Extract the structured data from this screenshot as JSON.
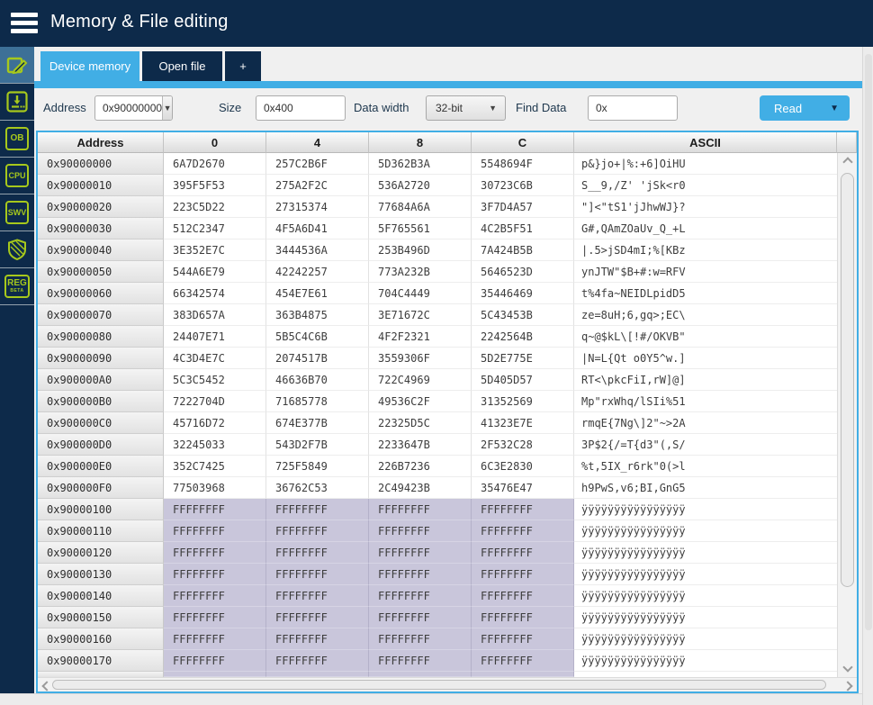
{
  "header": {
    "title": "Memory & File editing"
  },
  "sidebar": {
    "items": [
      {
        "id": "memory-edit",
        "icon": "pencil-edit-icon",
        "active": true
      },
      {
        "id": "erasing-programming",
        "icon": "download-icon",
        "active": false
      },
      {
        "id": "option-bytes",
        "label": "OB",
        "active": false
      },
      {
        "id": "cpu",
        "label": "CPU",
        "active": false
      },
      {
        "id": "swv",
        "label": "SWV",
        "active": false
      },
      {
        "id": "security",
        "icon": "shield-icon",
        "active": false
      },
      {
        "id": "register-viewer",
        "label": "REG",
        "sub": "BETA",
        "active": false
      }
    ]
  },
  "tabs": [
    {
      "label": "Device memory",
      "active": true
    },
    {
      "label": "Open file",
      "active": false
    },
    {
      "label": "+",
      "active": false
    }
  ],
  "toolbar": {
    "address_label": "Address",
    "address_value": "0x90000000",
    "size_label": "Size",
    "size_value": "0x400",
    "data_width_label": "Data width",
    "data_width_value": "32-bit",
    "find_label": "Find Data",
    "find_value": "0x",
    "read_label": "Read"
  },
  "table": {
    "columns": [
      "Address",
      "0",
      "4",
      "8",
      "C",
      "ASCII"
    ],
    "rows": [
      {
        "address": "0x90000000",
        "values": [
          "6A7D2670",
          "257C2B6F",
          "5D362B3A",
          "5548694F"
        ],
        "ascii": "p&}jo+|%:+6]OiHU",
        "highlight": false
      },
      {
        "address": "0x90000010",
        "values": [
          "395F5F53",
          "275A2F2C",
          "536A2720",
          "30723C6B"
        ],
        "ascii": "S__9,/Z' 'jSk<r0",
        "highlight": false
      },
      {
        "address": "0x90000020",
        "values": [
          "223C5D22",
          "27315374",
          "77684A6A",
          "3F7D4A57"
        ],
        "ascii": "\"]<\"tS1'jJhwWJ}?",
        "highlight": false
      },
      {
        "address": "0x90000030",
        "values": [
          "512C2347",
          "4F5A6D41",
          "5F765561",
          "4C2B5F51"
        ],
        "ascii": "G#,QAmZOaUv_Q_+L",
        "highlight": false
      },
      {
        "address": "0x90000040",
        "values": [
          "3E352E7C",
          "3444536A",
          "253B496D",
          "7A424B5B"
        ],
        "ascii": "|.5>jSD4mI;%[KBz",
        "highlight": false
      },
      {
        "address": "0x90000050",
        "values": [
          "544A6E79",
          "42242257",
          "773A232B",
          "5646523D"
        ],
        "ascii": "ynJTW\"$B+#:w=RFV",
        "highlight": false
      },
      {
        "address": "0x90000060",
        "values": [
          "66342574",
          "454E7E61",
          "704C4449",
          "35446469"
        ],
        "ascii": "t%4fa~NEIDLpidD5",
        "highlight": false
      },
      {
        "address": "0x90000070",
        "values": [
          "383D657A",
          "363B4875",
          "3E71672C",
          "5C43453B"
        ],
        "ascii": "ze=8uH;6,gq>;EC\\",
        "highlight": false
      },
      {
        "address": "0x90000080",
        "values": [
          "24407E71",
          "5B5C4C6B",
          "4F2F2321",
          "2242564B"
        ],
        "ascii": "q~@$kL\\[!#/OKVB\"",
        "highlight": false
      },
      {
        "address": "0x90000090",
        "values": [
          "4C3D4E7C",
          "2074517B",
          "3559306F",
          "5D2E775E"
        ],
        "ascii": "|N=L{Qt o0Y5^w.]",
        "highlight": false
      },
      {
        "address": "0x900000A0",
        "values": [
          "5C3C5452",
          "46636B70",
          "722C4969",
          "5D405D57"
        ],
        "ascii": "RT<\\pkcFiI,rW]@]",
        "highlight": false
      },
      {
        "address": "0x900000B0",
        "values": [
          "7222704D",
          "71685778",
          "49536C2F",
          "31352569"
        ],
        "ascii": "Mp\"rxWhq/lSIi%51",
        "highlight": false
      },
      {
        "address": "0x900000C0",
        "values": [
          "45716D72",
          "674E377B",
          "22325D5C",
          "41323E7E"
        ],
        "ascii": "rmqE{7Ng\\]2\"~>2A",
        "highlight": false
      },
      {
        "address": "0x900000D0",
        "values": [
          "32245033",
          "543D2F7B",
          "2233647B",
          "2F532C28"
        ],
        "ascii": "3P$2{/=T{d3\"(,S/",
        "highlight": false
      },
      {
        "address": "0x900000E0",
        "values": [
          "352C7425",
          "725F5849",
          "226B7236",
          "6C3E2830"
        ],
        "ascii": "%t,5IX_r6rk\"0(>l",
        "highlight": false
      },
      {
        "address": "0x900000F0",
        "values": [
          "77503968",
          "36762C53",
          "2C49423B",
          "35476E47"
        ],
        "ascii": "h9PwS,v6;BI,GnG5",
        "highlight": false
      },
      {
        "address": "0x90000100",
        "values": [
          "FFFFFFFF",
          "FFFFFFFF",
          "FFFFFFFF",
          "FFFFFFFF"
        ],
        "ascii": "ÿÿÿÿÿÿÿÿÿÿÿÿÿÿÿÿ",
        "highlight": true
      },
      {
        "address": "0x90000110",
        "values": [
          "FFFFFFFF",
          "FFFFFFFF",
          "FFFFFFFF",
          "FFFFFFFF"
        ],
        "ascii": "ÿÿÿÿÿÿÿÿÿÿÿÿÿÿÿÿ",
        "highlight": true
      },
      {
        "address": "0x90000120",
        "values": [
          "FFFFFFFF",
          "FFFFFFFF",
          "FFFFFFFF",
          "FFFFFFFF"
        ],
        "ascii": "ÿÿÿÿÿÿÿÿÿÿÿÿÿÿÿÿ",
        "highlight": true
      },
      {
        "address": "0x90000130",
        "values": [
          "FFFFFFFF",
          "FFFFFFFF",
          "FFFFFFFF",
          "FFFFFFFF"
        ],
        "ascii": "ÿÿÿÿÿÿÿÿÿÿÿÿÿÿÿÿ",
        "highlight": true
      },
      {
        "address": "0x90000140",
        "values": [
          "FFFFFFFF",
          "FFFFFFFF",
          "FFFFFFFF",
          "FFFFFFFF"
        ],
        "ascii": "ÿÿÿÿÿÿÿÿÿÿÿÿÿÿÿÿ",
        "highlight": true
      },
      {
        "address": "0x90000150",
        "values": [
          "FFFFFFFF",
          "FFFFFFFF",
          "FFFFFFFF",
          "FFFFFFFF"
        ],
        "ascii": "ÿÿÿÿÿÿÿÿÿÿÿÿÿÿÿÿ",
        "highlight": true
      },
      {
        "address": "0x90000160",
        "values": [
          "FFFFFFFF",
          "FFFFFFFF",
          "FFFFFFFF",
          "FFFFFFFF"
        ],
        "ascii": "ÿÿÿÿÿÿÿÿÿÿÿÿÿÿÿÿ",
        "highlight": true
      },
      {
        "address": "0x90000170",
        "values": [
          "FFFFFFFF",
          "FFFFFFFF",
          "FFFFFFFF",
          "FFFFFFFF"
        ],
        "ascii": "ÿÿÿÿÿÿÿÿÿÿÿÿÿÿÿÿ",
        "highlight": true
      }
    ]
  },
  "colors": {
    "accent_blue": "#41aee5",
    "navy": "#0d2a4a",
    "icon_green": "#a6c81c",
    "highlight_lavender": "#c9c6db",
    "background": "#f0f0f0"
  }
}
